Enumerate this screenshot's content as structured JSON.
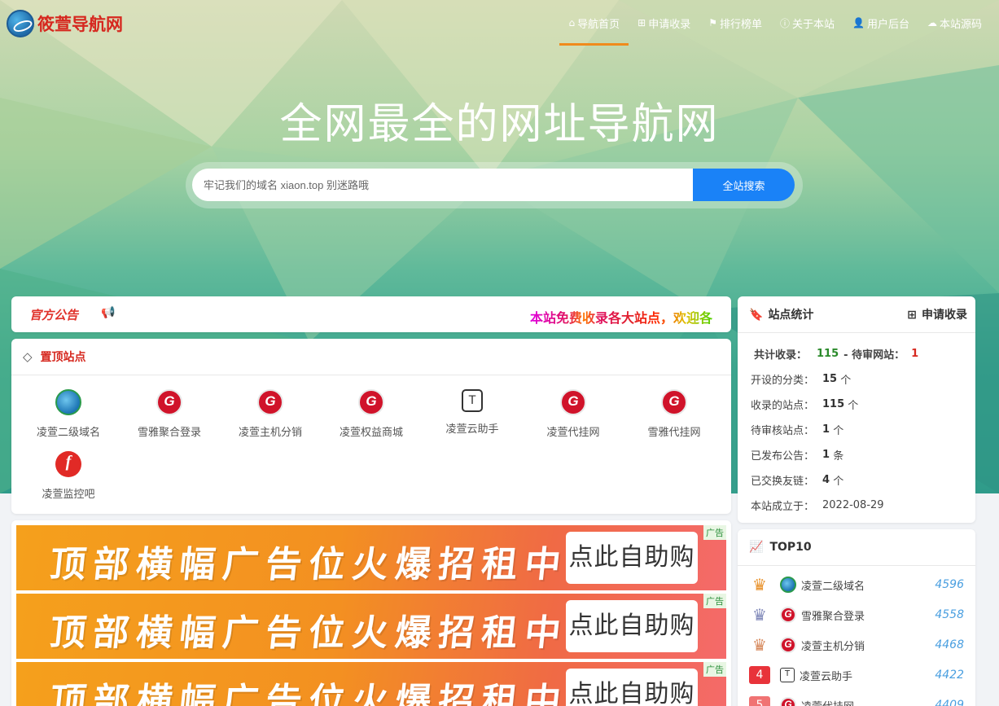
{
  "site": {
    "name": "筱萱导航网"
  },
  "nav": [
    {
      "icon": "home-icon",
      "glyph": "⌂",
      "label": "导航首页",
      "active": true
    },
    {
      "icon": "plus-square-icon",
      "glyph": "⊞",
      "label": "申请收录"
    },
    {
      "icon": "flag-icon",
      "glyph": "⚑",
      "label": "排行榜单"
    },
    {
      "icon": "info-circle-icon",
      "glyph": "ⓘ",
      "label": "关于本站"
    },
    {
      "icon": "user-icon",
      "glyph": "👤",
      "label": "用户后台"
    },
    {
      "icon": "cloud-download-icon",
      "glyph": "☁",
      "label": "本站源码"
    }
  ],
  "hero": {
    "title": "全网最全的网址导航网",
    "search_placeholder": "牢记我们的域名 xiaon.top 别迷路哦",
    "search_button": "全站搜索"
  },
  "notice": {
    "label": "官方公告",
    "icon": "bullhorn-icon",
    "marquee": "本站免费收录各大站点，欢迎各"
  },
  "pinned": {
    "title": "置顶站点",
    "icon": "diamond-icon",
    "sites": [
      {
        "name": "凌萱二级域名",
        "icon": "blue-logo-icon"
      },
      {
        "name": "雪雅聚合登录",
        "icon": "red-g-logo-icon"
      },
      {
        "name": "凌萱主机分销",
        "icon": "red-g-logo-icon"
      },
      {
        "name": "凌萱权益商城",
        "icon": "red-g-logo-icon"
      },
      {
        "name": "凌萱云助手",
        "icon": "tshirt-logo-icon"
      },
      {
        "name": "凌萱代挂网",
        "icon": "red-g-logo-icon"
      },
      {
        "name": "雪雅代挂网",
        "icon": "red-g-logo-icon"
      },
      {
        "name": "凌萱监控吧",
        "icon": "red-f-logo-icon"
      }
    ]
  },
  "ads": [
    {
      "text": "顶部横幅广告位火爆招租中……",
      "button": "点此自助购买",
      "tag": "广告"
    },
    {
      "text": "顶部横幅广告位火爆招租中……",
      "button": "点此自助购买",
      "tag": "广告"
    },
    {
      "text": "顶部横幅广告位火爆招租中……",
      "button": "点此自助购买",
      "tag": "广告"
    }
  ],
  "stats": {
    "title": "站点统计",
    "apply_label": "申请收录",
    "total_label": "共计收录：",
    "total_value": "115",
    "pending_label": "- 待审网站：",
    "pending_value": "1",
    "rows": [
      {
        "label": "开设的分类：",
        "value": "15",
        "unit": "个"
      },
      {
        "label": "收录的站点：",
        "value": "115",
        "unit": "个"
      },
      {
        "label": "待审核站点：",
        "value": "1",
        "unit": "个"
      },
      {
        "label": "已发布公告：",
        "value": "1",
        "unit": "条"
      },
      {
        "label": "已交换友链：",
        "value": "4",
        "unit": "个"
      },
      {
        "label": "本站成立于：",
        "value": "2022-08-29",
        "unit": ""
      }
    ]
  },
  "top10": {
    "title": "TOP10",
    "items": [
      {
        "rank": "1",
        "name": "凌萱二级域名",
        "count": "4596",
        "icon": "blue-logo-icon",
        "badge_color": "#e8912a"
      },
      {
        "rank": "2",
        "name": "雪雅聚合登录",
        "count": "4558",
        "icon": "red-g-logo-icon",
        "badge_color": "#7f87b8"
      },
      {
        "rank": "3",
        "name": "凌萱主机分销",
        "count": "4468",
        "icon": "red-g-logo-icon",
        "badge_color": "#d6875a"
      },
      {
        "rank": "4",
        "name": "凌萱云助手",
        "count": "4422",
        "icon": "tshirt-logo-icon",
        "badge_color": "#e8333a"
      },
      {
        "rank": "5",
        "name": "凌萱代挂网",
        "count": "4409",
        "icon": "red-g-logo-icon",
        "badge_color": "#f07373"
      }
    ]
  }
}
